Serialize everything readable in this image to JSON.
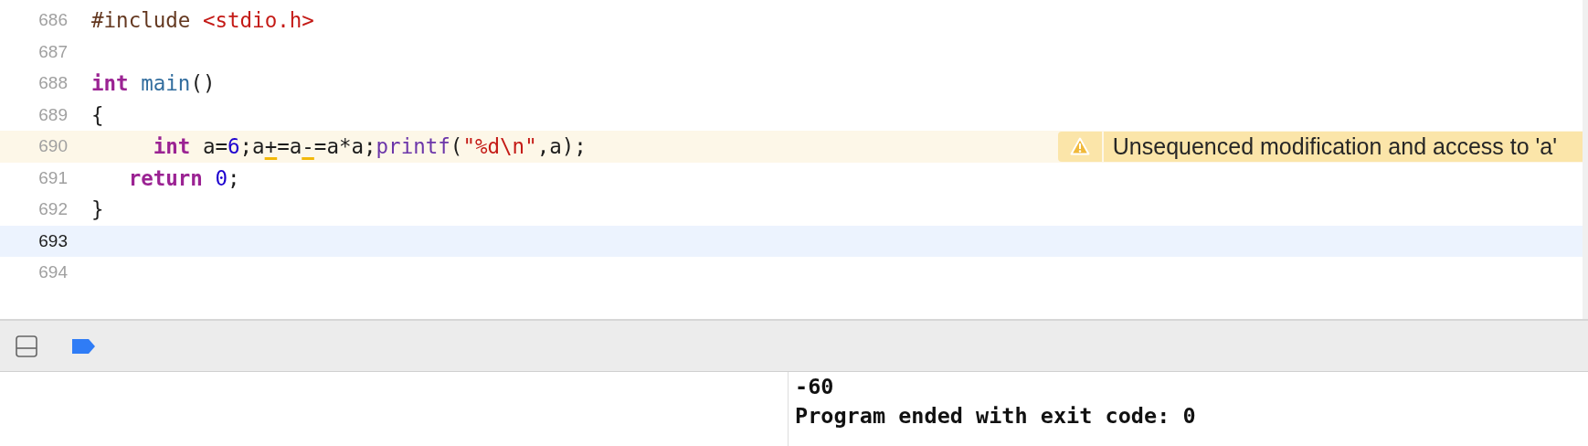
{
  "editor": {
    "lines": [
      {
        "number": "686",
        "selected": false,
        "warning": false,
        "tokens": [
          {
            "text": "#include ",
            "kind": "preproc"
          },
          {
            "text": "<stdio.h>",
            "kind": "string"
          }
        ]
      },
      {
        "number": "687",
        "selected": false,
        "warning": false
      },
      {
        "number": "688",
        "selected": false,
        "warning": false,
        "tokens": [
          {
            "text": "int ",
            "kind": "keyword"
          },
          {
            "text": "main",
            "kind": "function"
          },
          {
            "text": "()",
            "kind": "plain"
          }
        ]
      },
      {
        "number": "689",
        "selected": false,
        "warning": false,
        "tokens": [
          {
            "text": "{",
            "kind": "plain"
          }
        ]
      },
      {
        "number": "690",
        "selected": false,
        "warning": true,
        "tokens": [
          {
            "text": "     int",
            "kind": "keyword"
          },
          {
            "text": " a=",
            "kind": "plain"
          },
          {
            "text": "6",
            "kind": "number"
          },
          {
            "text": ";a",
            "kind": "plain"
          },
          {
            "text": "+",
            "kind": "flagged"
          },
          {
            "text": "=a",
            "kind": "plain"
          },
          {
            "text": "-",
            "kind": "flagged"
          },
          {
            "text": "=a*a;",
            "kind": "plain"
          },
          {
            "text": "printf",
            "kind": "library"
          },
          {
            "text": "(",
            "kind": "plain"
          },
          {
            "text": "\"%d\\n\"",
            "kind": "string"
          },
          {
            "text": ",a);",
            "kind": "plain"
          }
        ],
        "issue": "Unsequenced modification and access to 'a'"
      },
      {
        "number": "691",
        "selected": false,
        "warning": false,
        "tokens": [
          {
            "text": "   return",
            "kind": "keyword"
          },
          {
            "text": " 0",
            "kind": "number"
          },
          {
            "text": ";",
            "kind": "plain"
          }
        ]
      },
      {
        "number": "692",
        "selected": false,
        "warning": false,
        "tokens": [
          {
            "text": "}",
            "kind": "plain"
          }
        ]
      },
      {
        "number": "693",
        "selected": true,
        "warning": false
      },
      {
        "number": "694",
        "selected": false,
        "warning": false
      }
    ]
  },
  "debug_bar": {
    "breakpoints_active": true
  },
  "console": {
    "output": [
      "-60",
      "Program ended with exit code: 0"
    ]
  }
}
